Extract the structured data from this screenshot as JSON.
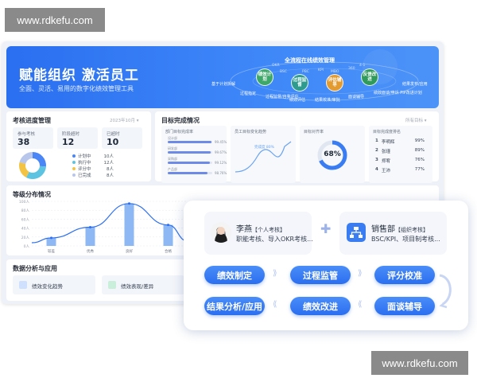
{
  "watermark": "www.rdkefu.com",
  "banner": {
    "title": "赋能组织  激活员工",
    "subtitle": "全面、灵活、易用的数字化绩效管理工具",
    "flow_title": "全流程在线绩效管理",
    "nodes": [
      "绩效计划",
      "过程监督",
      "评估辅导",
      "反馈改进"
    ],
    "labels": [
      "基于计划拆解",
      "过程指定",
      "过程监督/自我评估",
      "绩效评估",
      "结果校准/审批",
      "面谈辅导",
      "绩效面谈/申诉 PIP改进计划",
      "结果发布/应用"
    ],
    "tags": [
      "OKR",
      "BSC",
      "PBC",
      "KPI",
      "MBO",
      "360",
      "4-1"
    ]
  },
  "progress": {
    "title": "考核进度管理",
    "meta": "2023年10月 ▾",
    "stats": [
      {
        "label": "参与考核",
        "value": "38"
      },
      {
        "label": "阶段超时",
        "value": "12"
      },
      {
        "label": "已超时",
        "value": "10"
      }
    ],
    "legend": [
      {
        "label": "计划中",
        "count": "10人",
        "color": "#4a86f5"
      },
      {
        "label": "执行中",
        "count": "12人",
        "color": "#5cc4e0"
      },
      {
        "label": "评分中",
        "count": "8人",
        "color": "#f3c343"
      },
      {
        "label": "已完成",
        "count": "8人",
        "color": "#b7c6ea"
      }
    ]
  },
  "goals": {
    "title": "目标完成情况",
    "meta": "所有目标 ▾",
    "panels": [
      "部门目标完成率",
      "员工目标变化趋势",
      "目标对齐率",
      "目标完成度排名"
    ],
    "bars": [
      {
        "label": "设计部",
        "value": "99.45%",
        "fill": 0.99
      },
      {
        "label": "研发部",
        "value": "99.67%",
        "fill": 0.97
      },
      {
        "label": "采购部",
        "value": "99.12%",
        "fill": 0.94
      },
      {
        "label": "产品部",
        "value": "98.76%",
        "fill": 0.9
      }
    ],
    "trend_note": "完成度 80%",
    "alignment": "68%",
    "ranking": [
      {
        "rank": "1",
        "name": "李明辉",
        "value": "99%"
      },
      {
        "rank": "2",
        "name": "张瑾",
        "value": "89%"
      },
      {
        "rank": "3",
        "name": "郑宥",
        "value": "76%"
      },
      {
        "rank": "4",
        "name": "王沛",
        "value": "77%"
      }
    ]
  },
  "distribution": {
    "title": "等级分布情况",
    "chart_data": {
      "type": "bar",
      "categories": [
        "较差",
        "优秀",
        "良好",
        "合格"
      ],
      "values": [
        18,
        42,
        95,
        47
      ],
      "ylim": [
        0,
        100
      ],
      "yticks": [
        "100人",
        "80人",
        "60人",
        "40人",
        "20人",
        "0人"
      ]
    }
  },
  "analysis": {
    "title": "数据分析与应用",
    "items": [
      "绩效变化趋势",
      "绩效表现/差异"
    ]
  },
  "workflow": {
    "person": {
      "name": "李燕",
      "tag": "【个人考核】",
      "desc": "职能考核、导入OKR考核..."
    },
    "dept": {
      "name": "销售部",
      "tag": "【组织考核】",
      "desc": "BSC/KPI、项目制考核..."
    },
    "steps": [
      "绩效制定",
      "过程监管",
      "评分校准",
      "结果分析/应用",
      "绩效改进",
      "面谈辅导"
    ]
  }
}
